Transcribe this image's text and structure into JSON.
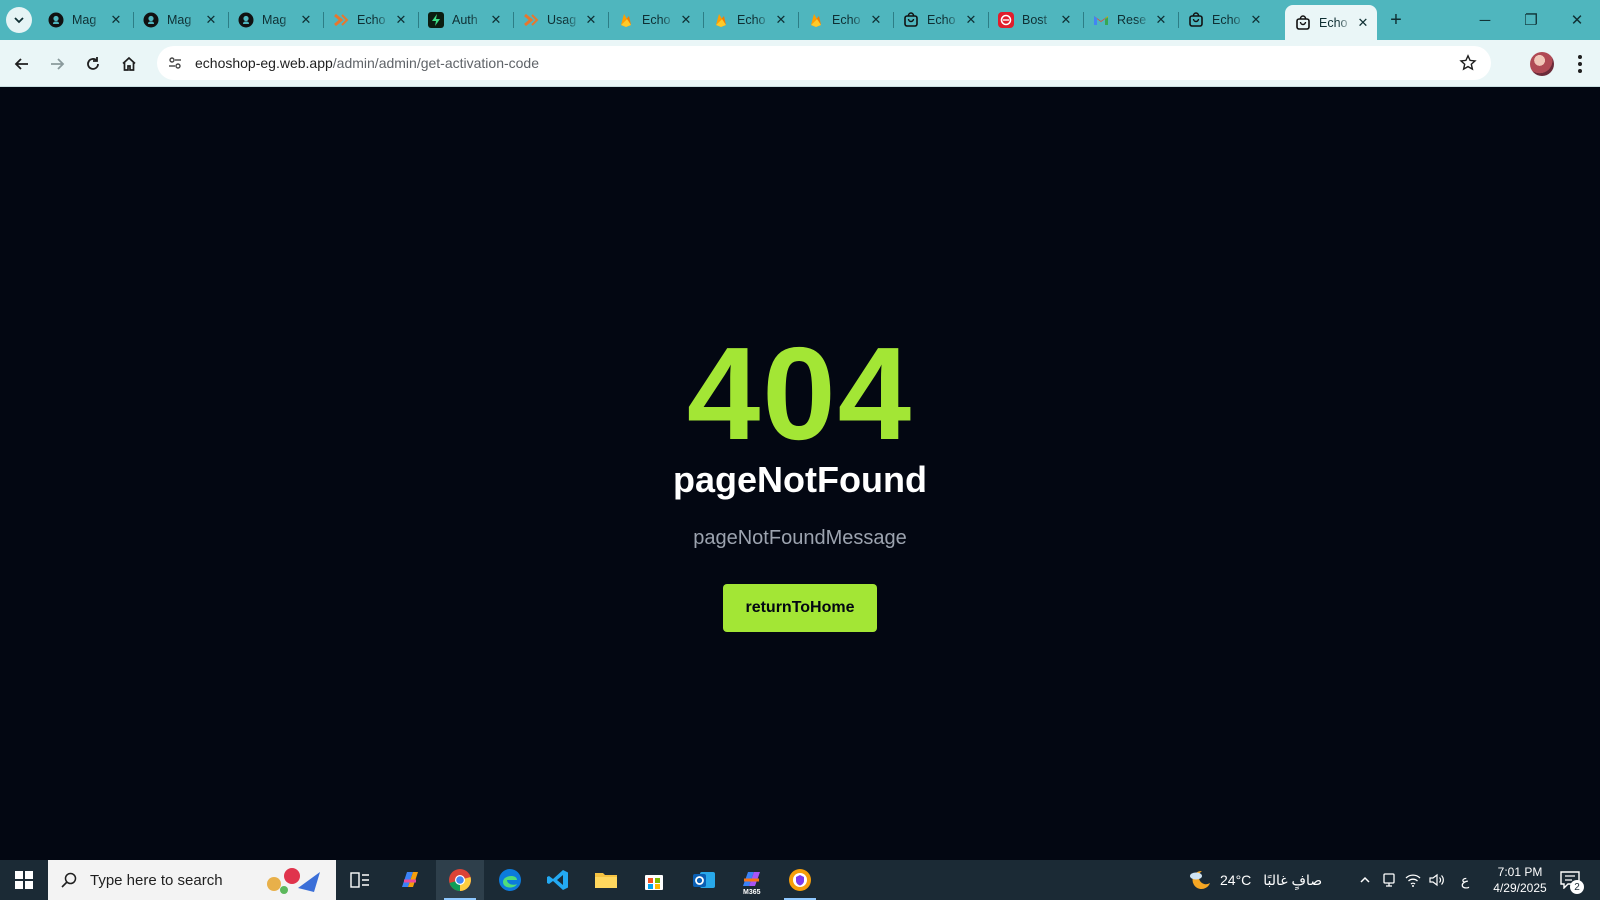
{
  "browser": {
    "tabs": [
      {
        "title": "Mag",
        "icon": "github-icon"
      },
      {
        "title": "Mag",
        "icon": "github-icon"
      },
      {
        "title": "Mag",
        "icon": "github-icon"
      },
      {
        "title": "Echo",
        "icon": "echo-brand-icon"
      },
      {
        "title": "Auth",
        "icon": "auth-app-icon"
      },
      {
        "title": "Usag",
        "icon": "echo-brand-icon"
      },
      {
        "title": "Echo",
        "icon": "firebase-icon"
      },
      {
        "title": "Echo",
        "icon": "firebase-icon"
      },
      {
        "title": "Echo",
        "icon": "firebase-icon"
      },
      {
        "title": "Echo",
        "icon": "shopping-bag-icon"
      },
      {
        "title": "Bost",
        "icon": "bostman-icon"
      },
      {
        "title": "Rese",
        "icon": "gmail-icon"
      },
      {
        "title": "Echo",
        "icon": "shopping-bag-icon"
      },
      {
        "title": "Echo",
        "icon": "shopping-bag-icon",
        "active": true
      }
    ],
    "url_domain": "echoshop-eg.web.app",
    "url_path": "/admin/admin/get-activation-code",
    "accent_color": "#4fb6be"
  },
  "page": {
    "code": "404",
    "title": "pageNotFound",
    "message": "pageNotFoundMessage",
    "button_label": "returnToHome",
    "accent_color": "#a3e635",
    "background": "#030712"
  },
  "taskbar": {
    "search_placeholder": "Type here to search",
    "weather_temp": "24°C",
    "weather_desc": "صافٍ غالبًا",
    "input_lang": "ع",
    "time": "7:01 PM",
    "date": "4/29/2025",
    "notification_count": "2",
    "m365_label": "M365"
  }
}
